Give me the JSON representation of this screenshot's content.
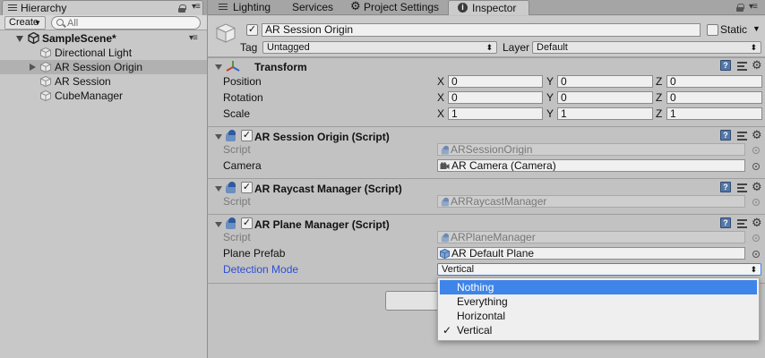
{
  "hierarchy": {
    "tab_label": "Hierarchy",
    "create_label": "Create",
    "search_placeholder": "All",
    "scene_name": "SampleScene*",
    "items": [
      {
        "label": "Directional Light"
      },
      {
        "label": "AR Session Origin"
      },
      {
        "label": "AR Session"
      },
      {
        "label": "CubeManager"
      }
    ]
  },
  "tabs": [
    {
      "label": "Lighting",
      "icon": "menu-lines-icon"
    },
    {
      "label": "Services",
      "icon": ""
    },
    {
      "label": "Project Settings",
      "icon": "gear-icon"
    },
    {
      "label": "Inspector",
      "icon": "info-icon"
    }
  ],
  "inspector": {
    "object_name": "AR Session Origin",
    "static_label": "Static",
    "tag_label": "Tag",
    "tag_value": "Untagged",
    "layer_label": "Layer",
    "layer_value": "Default",
    "transform": {
      "title": "Transform",
      "rows": [
        {
          "label": "Position",
          "x": "0",
          "y": "0",
          "z": "0"
        },
        {
          "label": "Rotation",
          "x": "0",
          "y": "0",
          "z": "0"
        },
        {
          "label": "Scale",
          "x": "1",
          "y": "1",
          "z": "1"
        }
      ],
      "axis_x": "X",
      "axis_y": "Y",
      "axis_z": "Z"
    },
    "ar_session_origin": {
      "title": "AR Session Origin (Script)",
      "script_label": "Script",
      "script_value": "ARSessionOrigin",
      "camera_label": "Camera",
      "camera_value": "AR Camera (Camera)"
    },
    "ar_raycast_manager": {
      "title": "AR Raycast Manager (Script)",
      "script_label": "Script",
      "script_value": "ARRaycastManager"
    },
    "ar_plane_manager": {
      "title": "AR Plane Manager (Script)",
      "script_label": "Script",
      "script_value": "ARPlaneManager",
      "prefab_label": "Plane Prefab",
      "prefab_value": "AR Default Plane",
      "mode_label": "Detection Mode",
      "mode_value": "Vertical"
    },
    "detection_options": [
      {
        "label": "Nothing",
        "highlighted": true,
        "checked": false
      },
      {
        "label": "Everything",
        "highlighted": false,
        "checked": false
      },
      {
        "label": "Horizontal",
        "highlighted": false,
        "checked": false
      },
      {
        "label": "Vertical",
        "highlighted": false,
        "checked": true
      }
    ],
    "checkmark": "✓"
  },
  "colors": {
    "highlight": "#3f84e8",
    "link_label": "#2d4fd6"
  }
}
